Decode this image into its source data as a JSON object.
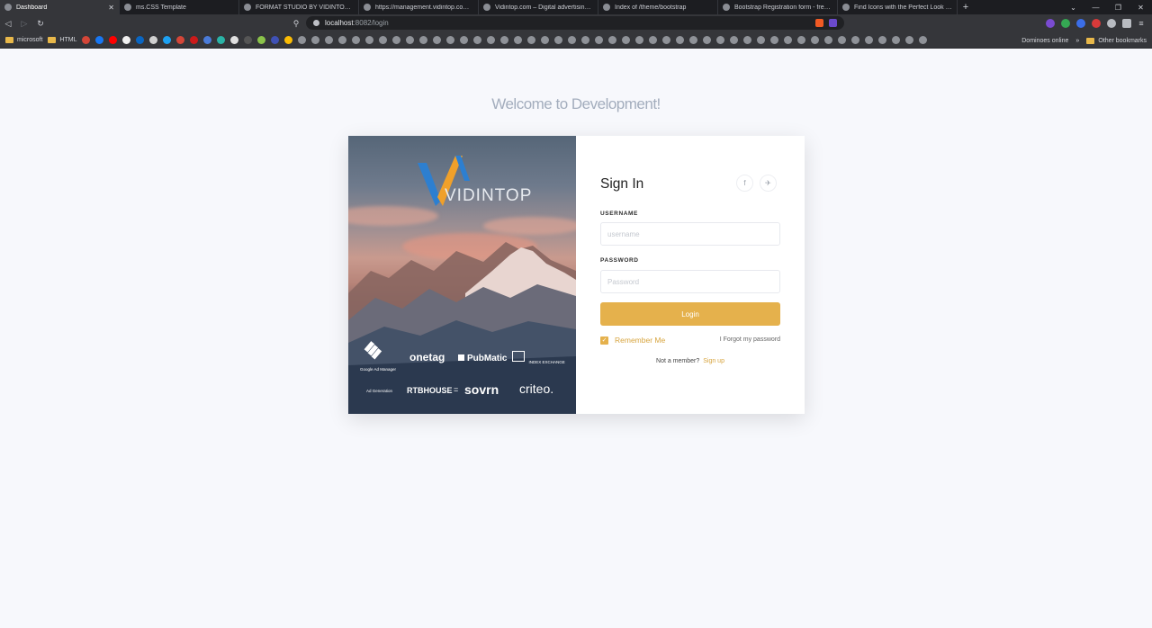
{
  "browser": {
    "tabs": [
      {
        "title": "Dashboard",
        "active": true
      },
      {
        "title": "ms.CSS Template",
        "active": false
      },
      {
        "title": "FORMAT STUDIO BY VIDINTOP.COM",
        "active": false
      },
      {
        "title": "https://management.vidintop.com/log",
        "active": false
      },
      {
        "title": "Vidintop.com – Digital advertising pla",
        "active": false
      },
      {
        "title": "Index of /theme/bootstrap",
        "active": false
      },
      {
        "title": "Bootstrap Registration form - free exa",
        "active": false
      },
      {
        "title": "Find Icons with the Perfect Look & Fe",
        "active": false
      }
    ],
    "url_host": "localhost",
    "url_path": ":8082/login",
    "bookmarks": {
      "microsoft": "microsoft",
      "html": "HTML",
      "dominoes": "Dominoes online",
      "overflow": "»",
      "other": "Other bookmarks"
    }
  },
  "page": {
    "welcome": "Welcome to Development!",
    "brand": "VIDINTOP",
    "partners": {
      "google": "Google Ad Manager",
      "onetag": "onetag",
      "pubmatic": "PubMatic",
      "index": "INDEX EXCHANGE",
      "adgeneration": "Ad Generation",
      "rtbhouse": "RTBHOUSE",
      "sovrn": "sovrn",
      "criteo": "criteo."
    }
  },
  "form": {
    "title": "Sign In",
    "username_label": "USERNAME",
    "username_placeholder": "username",
    "password_label": "PASSWORD",
    "password_placeholder": "Password",
    "login_label": "Login",
    "remember_label": "Remember Me",
    "remember_checked": true,
    "forgot_label": "I Forgot my password",
    "member_text": "Not a member?",
    "signup_label": "Sign up"
  },
  "colors": {
    "accent": "#e5b14c",
    "welcome_text": "#a3adbd",
    "page_bg": "#f7f8fc"
  }
}
